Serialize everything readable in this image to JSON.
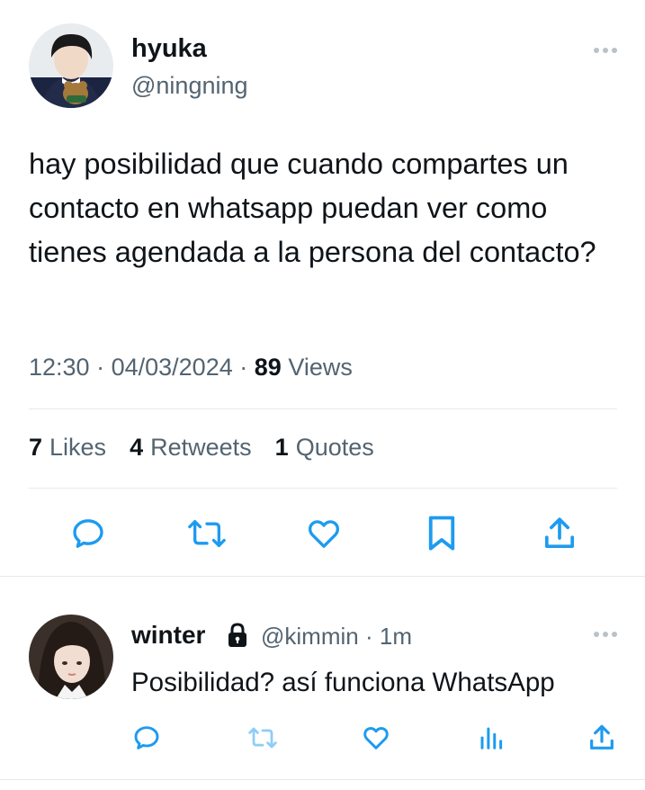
{
  "tweet": {
    "author_name": "hyuka",
    "author_handle": "@ningning",
    "text": "hay posibilidad que cuando compartes un contacto en whatsapp puedan ver como tienes agendada a la persona del contacto?",
    "time": "12:30",
    "date": "04/03/2024",
    "views_count": "89",
    "views_label": "Views",
    "stats": {
      "likes_count": "7",
      "likes_label": "Likes",
      "retweets_count": "4",
      "retweets_label": "Retweets",
      "quotes_count": "1",
      "quotes_label": "Quotes"
    },
    "actions": [
      "reply-icon",
      "retweet-icon",
      "like-icon",
      "bookmark-icon",
      "share-icon"
    ]
  },
  "reply": {
    "author_name": "winter",
    "author_handle": "@kimmin",
    "time_ago": "1m",
    "text": "Posibilidad? así funciona WhatsApp",
    "protected": true,
    "actions": [
      "reply-icon",
      "retweet-icon",
      "like-icon",
      "views-icon",
      "share-icon"
    ]
  },
  "colors": {
    "text_primary": "#0f1419",
    "text_secondary": "#536471",
    "icon": "#1d9bf0",
    "icon_muted": "#8ecdf7",
    "divider": "#e6e9ec"
  }
}
